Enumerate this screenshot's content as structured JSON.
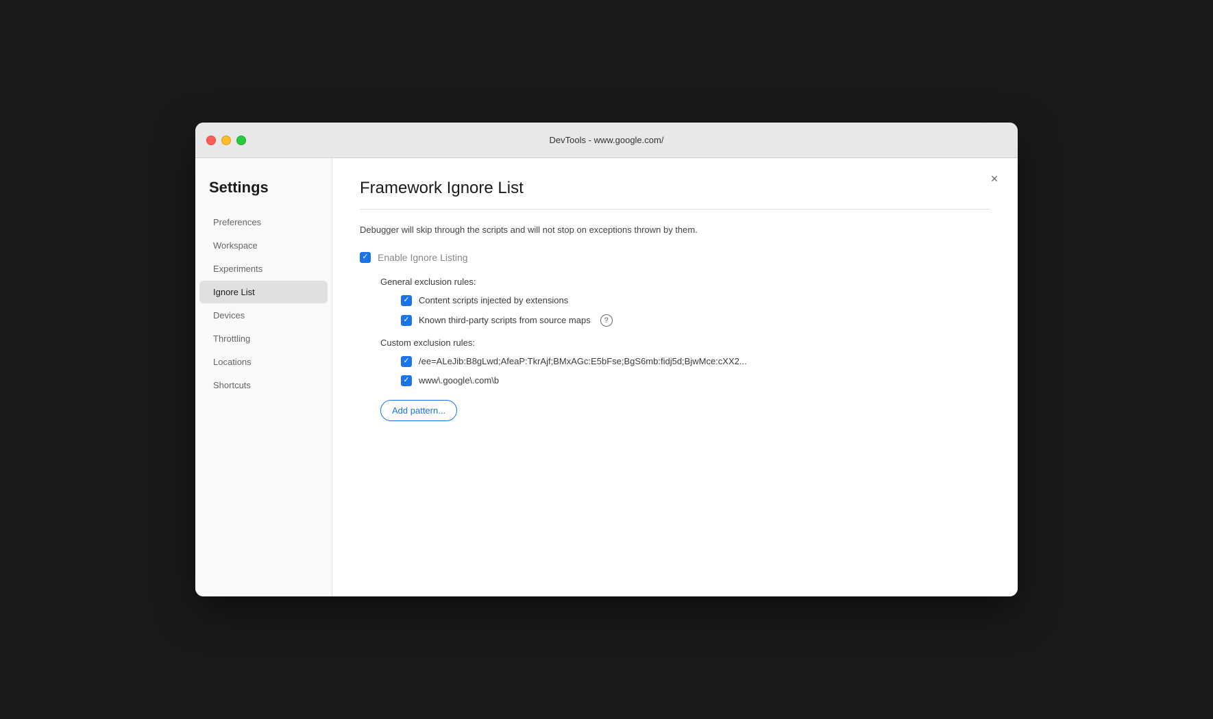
{
  "titlebar": {
    "title": "DevTools - www.google.com/"
  },
  "sidebar": {
    "title": "Settings",
    "items": [
      {
        "id": "preferences",
        "label": "Preferences",
        "active": false
      },
      {
        "id": "workspace",
        "label": "Workspace",
        "active": false
      },
      {
        "id": "experiments",
        "label": "Experiments",
        "active": false
      },
      {
        "id": "ignore-list",
        "label": "Ignore List",
        "active": true
      },
      {
        "id": "devices",
        "label": "Devices",
        "active": false
      },
      {
        "id": "throttling",
        "label": "Throttling",
        "active": false
      },
      {
        "id": "locations",
        "label": "Locations",
        "active": false
      },
      {
        "id": "shortcuts",
        "label": "Shortcuts",
        "active": false
      }
    ]
  },
  "main": {
    "title": "Framework Ignore List",
    "description": "Debugger will skip through the scripts and will not stop on exceptions thrown by them.",
    "enable_ignore_listing": {
      "label": "Enable Ignore Listing",
      "checked": true
    },
    "general_exclusion_rules": {
      "label": "General exclusion rules:",
      "rules": [
        {
          "id": "content-scripts",
          "label": "Content scripts injected by extensions",
          "checked": true,
          "has_help": false
        },
        {
          "id": "third-party-scripts",
          "label": "Known third-party scripts from source maps",
          "checked": true,
          "has_help": true
        }
      ]
    },
    "custom_exclusion_rules": {
      "label": "Custom exclusion rules:",
      "rules": [
        {
          "id": "custom-rule-1",
          "label": "/ee=ALeJib:B8gLwd;AfeaP:TkrAjf;BMxAGc:E5bFse;BgS6mb:fidj5d;BjwMce:cXX2...",
          "checked": true
        },
        {
          "id": "custom-rule-2",
          "label": "www\\.google\\.com\\b",
          "checked": true
        }
      ]
    },
    "add_pattern_button": "Add pattern..."
  },
  "close_button": "×"
}
